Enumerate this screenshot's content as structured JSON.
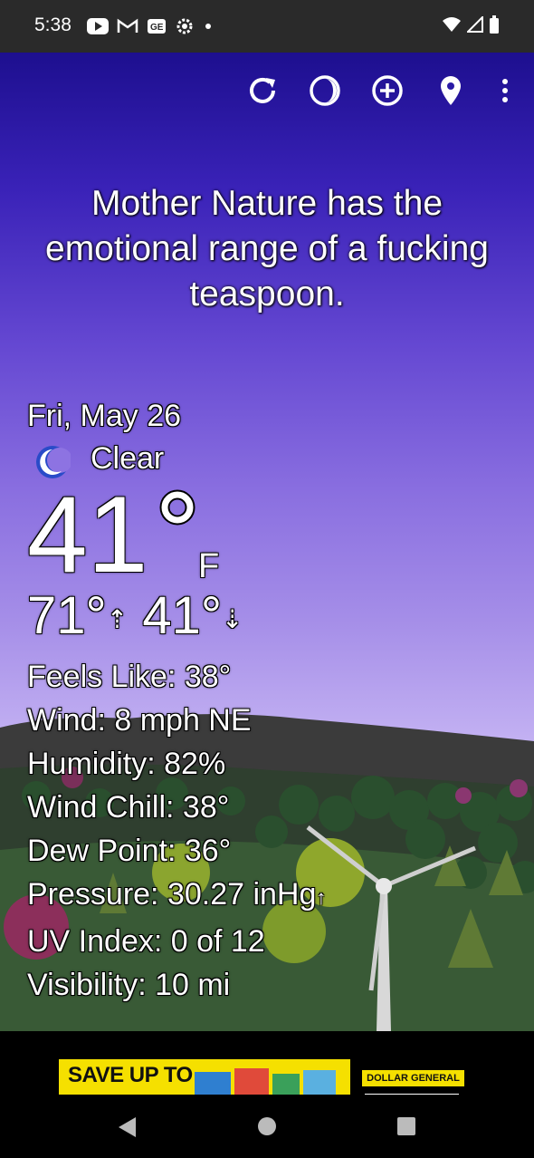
{
  "status_bar": {
    "time": "5:38",
    "notification_icons": [
      "youtube-icon",
      "gmail-icon",
      "news-icon",
      "settings-gear-icon",
      "dot-icon"
    ],
    "system_icons": [
      "wifi-icon",
      "cell-signal-icon",
      "battery-icon"
    ]
  },
  "toolbar": {
    "icons": [
      "refresh-icon",
      "moon-phase-icon",
      "add-location-icon",
      "location-pin-icon",
      "more-vert-icon"
    ]
  },
  "quote": "Mother Nature has the emotional range of a fucking teaspoon.",
  "current": {
    "date": "Fri, May 26",
    "condition": "Clear",
    "condition_icon": "crescent-moon-icon",
    "temperature": "41",
    "unit": "F",
    "high": "71°",
    "low": "41°"
  },
  "details": [
    "Feels Like:  38°",
    "Wind:  8 mph NE",
    "Humidity:  82%",
    "Wind Chill:  38°",
    "Dew Point:  36°",
    "Pressure:  30.27 inHg",
    "UV Index:  0 of 12",
    "Visibility:  10 mi"
  ],
  "ad": {
    "headline": "SAVE UP TO",
    "brand": "DOLLAR GENERAL"
  },
  "nav_bar": {
    "buttons": [
      "back-button",
      "home-button",
      "recents-button"
    ]
  },
  "colors": {
    "sky_top": "#1d0f8f",
    "sky_bottom": "#ccc0f4",
    "ad_yellow": "#f5e000"
  }
}
